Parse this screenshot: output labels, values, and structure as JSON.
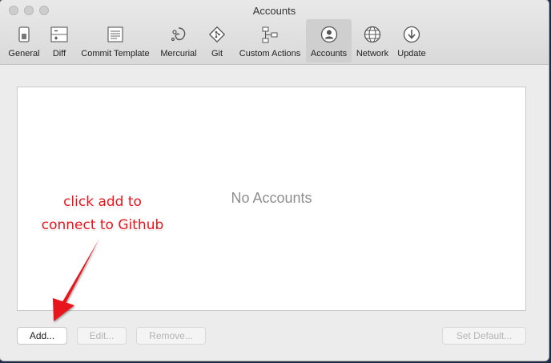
{
  "window": {
    "title": "Accounts"
  },
  "toolbar": {
    "items": [
      {
        "label": "General",
        "icon": "general-switch-icon"
      },
      {
        "label": "Diff",
        "icon": "diff-icon"
      },
      {
        "label": "Commit Template",
        "icon": "commit-template-icon"
      },
      {
        "label": "Mercurial",
        "icon": "mercurial-icon"
      },
      {
        "label": "Git",
        "icon": "git-icon"
      },
      {
        "label": "Custom Actions",
        "icon": "custom-actions-icon"
      },
      {
        "label": "Accounts",
        "icon": "accounts-icon",
        "selected": true
      },
      {
        "label": "Network",
        "icon": "network-globe-icon"
      },
      {
        "label": "Update",
        "icon": "update-download-icon"
      }
    ]
  },
  "accounts": {
    "empty_text": "No Accounts"
  },
  "buttons": {
    "add": "Add...",
    "edit": "Edit...",
    "remove": "Remove...",
    "set_default": "Set Default..."
  },
  "annotation": {
    "line1": "click add to",
    "line2": "connect to Github",
    "color": "#e8141c"
  }
}
